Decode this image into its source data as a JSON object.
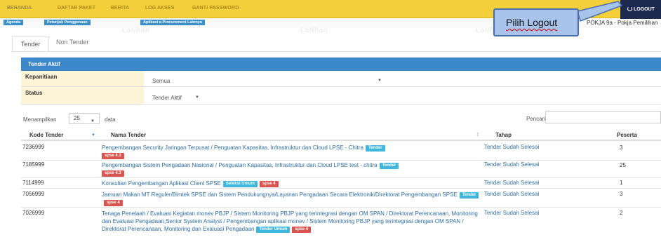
{
  "nav": {
    "items": [
      "BERANDA",
      "DAFTAR PAKET",
      "BERITA",
      "LOG AKSES",
      "GANTI PASSWORD"
    ],
    "logout": "LOGOUT"
  },
  "info": {
    "pills": [
      "Agenda",
      "Petunjuk Penggunaan",
      "Aplikasi e-Procurement Lainnya"
    ],
    "pokja": "POKJA 9a - Pokja Pemilihan",
    "watermark": "Latihan"
  },
  "callout": {
    "text": "Pilih Logout"
  },
  "tabs": {
    "tender": "Tender",
    "non_tender": "Non Tender"
  },
  "panel": {
    "title": "Tender Aktif",
    "filters": [
      {
        "label": "Kepanitiaan",
        "value": "Semua"
      },
      {
        "label": "Status",
        "value": "Tender Aktif"
      }
    ]
  },
  "list_controls": {
    "show_label": "Menampilkan",
    "page_size": "25",
    "suffix": "data",
    "search_label": "Pencarian",
    "search_value": ""
  },
  "table": {
    "headers": {
      "code": "Kode Tender",
      "name": "Nama Tender",
      "stage": "Tahap",
      "participants": "Peserta"
    },
    "rows": [
      {
        "code": "7236999",
        "name": "Pengembangan Security Jaringan Terpusat / Penguatan Kapasitas, Infrastruktur dan Cloud LPSE - Chitra",
        "badge1": "Tender",
        "badge2": "spse 4.3",
        "stage": "Tender Sudah Selesai",
        "participants": "3"
      },
      {
        "code": "7185999",
        "name": "Pengembangan Sistem Pengadaan Nasional / Penguatan Kapasitas, Infrastruktur dan Cloud LPSE test - chitra",
        "badge1": "Tender",
        "badge2": "spse 4.3",
        "stage": "Tender Sudah Selesai",
        "participants": "25"
      },
      {
        "code": "7114999",
        "name": "Konsultan Pengembangan Aplikasi Client SPSE",
        "badge1": "Seleksi Umum",
        "badge2": "spse 4",
        "stage": "Tender Sudah Selesai",
        "participants": "1"
      },
      {
        "code": "7056999",
        "name": "Jamuan Makan MT Reguler/Bimtek SPSE dan Sistem Pendukungnya/Layanan Pengadaan Secara Elektronik/Direktorat Pengembangan SPSE",
        "badge1": "Tender",
        "badge2": "spse 4",
        "stage": "Tender Sudah Selesai",
        "participants": "3"
      },
      {
        "code": "7026999",
        "name": "Tenaga Penelaah / Evaluasi Kegiatan monev PBJP / Sistem Monitoring PBJP yang terintegrasi dengan OM SPAN / Direktorat Perencanaan, Monitoring dan Evaluasi Pengadaan,Senior System Analyst / Pengembangan aplikasi monev / Sistem Monitoring PBJP yang terintegrasi dengan OM SPAN / Direktorat Perencanaan, Monitoring dan Evaluasi Pengadaan",
        "badge1": "Tender Umum",
        "badge2": "spse 4",
        "stage": "Tender Sudah Selesai",
        "participants": "2"
      }
    ]
  },
  "colors": {
    "nav_bg": "#f3cf3a",
    "logout_bg": "#1d2a4f",
    "panel_head": "#3b87c8",
    "callout_bg": "#a9c4ea",
    "badge_blue": "#3fb6dc",
    "badge_red": "#d9534f"
  },
  "icons": {
    "logout": "power-icon",
    "sort": "sort-arrow-icon",
    "dropdown": "caret-down-icon"
  }
}
